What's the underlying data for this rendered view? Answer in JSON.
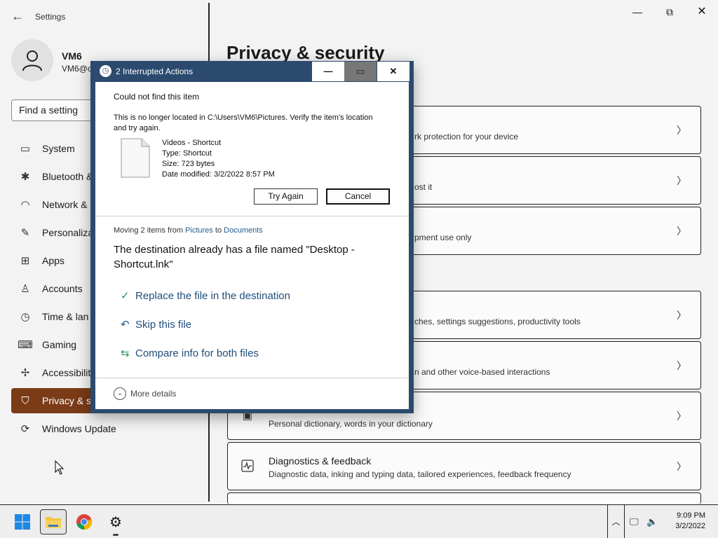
{
  "settings": {
    "app_title": "Settings",
    "user": {
      "name": "VM6",
      "email": "VM6@c"
    },
    "search_placeholder": "Find a setting",
    "nav": [
      {
        "label": "System",
        "icon": "monitor-icon",
        "glyph": "▭"
      },
      {
        "label": "Bluetooth &",
        "icon": "bluetooth-icon",
        "glyph": "✱"
      },
      {
        "label": "Network &",
        "icon": "wifi-icon",
        "glyph": "◠"
      },
      {
        "label": "Personaliza",
        "icon": "brush-icon",
        "glyph": "✎"
      },
      {
        "label": "Apps",
        "icon": "apps-icon",
        "glyph": "⊞"
      },
      {
        "label": "Accounts",
        "icon": "person-icon",
        "glyph": "♙"
      },
      {
        "label": "Time & lan",
        "icon": "clock-language-icon",
        "glyph": "◷"
      },
      {
        "label": "Gaming",
        "icon": "gamepad-icon",
        "glyph": "⌨"
      },
      {
        "label": "Accessibilit",
        "icon": "accessibility-icon",
        "glyph": "✢"
      },
      {
        "label": "Privacy & s",
        "icon": "shield-icon",
        "glyph": "⛉",
        "active": true
      },
      {
        "label": "Windows Update",
        "icon": "update-icon",
        "glyph": "⟳"
      }
    ],
    "page_title": "Privacy & security",
    "cards": [
      {
        "subtitle": "rk protection for your device"
      },
      {
        "subtitle": "ost it"
      },
      {
        "subtitle": "pment use only"
      },
      {
        "subtitle": "ches, settings suggestions, productivity tools"
      },
      {
        "subtitle": "n and other voice-based interactions"
      },
      {
        "title": "",
        "subtitle": "Personal dictionary, words in your dictionary"
      },
      {
        "title": "Diagnostics & feedback",
        "subtitle": "Diagnostic data, inking and typing data, tailored experiences, feedback frequency"
      }
    ]
  },
  "dialog": {
    "title": "2 Interrupted Actions",
    "error_title": "Could not find this item",
    "error_message": "This is no longer located in C:\\Users\\VM6\\Pictures. Verify the item's location and try again.",
    "file": {
      "name": "Videos - Shortcut",
      "type": "Type: Shortcut",
      "size": "Size: 723 bytes",
      "date_modified": "Date modified: 3/2/2022 8:57 PM"
    },
    "try_again_label": "Try Again",
    "cancel_label": "Cancel",
    "moving": {
      "prefix": "Moving 2 items from ",
      "from": "Pictures",
      "middle": " to ",
      "to": "Documents"
    },
    "destination_message": "The destination already has a file named \"Desktop - Shortcut.lnk\"",
    "options": [
      {
        "label": "Replace the file in the destination",
        "icon": "checkmark-icon",
        "glyph": "✓",
        "color": "#2e8b57"
      },
      {
        "label": "Skip this file",
        "icon": "undo-icon",
        "glyph": "↶",
        "color": "#1f5a8a"
      },
      {
        "label": "Compare info for both files",
        "icon": "compare-icon",
        "glyph": "⇆",
        "color": "#2e8b57"
      }
    ],
    "more_details_label": "More details"
  },
  "taskbar": {
    "time": "9:09 PM",
    "date": "3/2/2022"
  }
}
